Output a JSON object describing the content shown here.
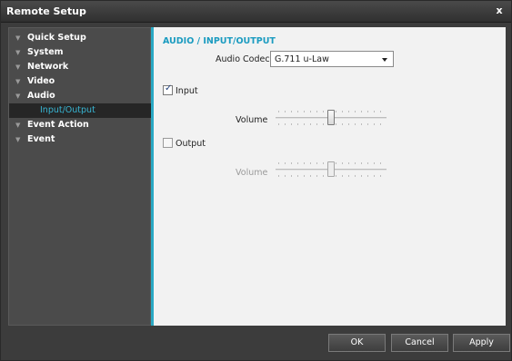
{
  "window": {
    "title": "Remote Setup",
    "close_label": "x"
  },
  "sidebar": {
    "items": [
      {
        "label": "Quick Setup"
      },
      {
        "label": "System"
      },
      {
        "label": "Network"
      },
      {
        "label": "Video"
      },
      {
        "label": "Audio"
      },
      {
        "label": "Event Action"
      },
      {
        "label": "Event"
      }
    ],
    "sub_items": [
      {
        "label": "Input/Output",
        "selected": true
      }
    ],
    "arrow_glyph": "▼"
  },
  "content": {
    "section_title": "AUDIO / INPUT/OUTPUT",
    "codec": {
      "label": "Audio Codec",
      "value": "G.711 u-Law"
    },
    "input": {
      "label": "Input",
      "checked": true,
      "volume_label": "Volume",
      "volume": 0.5
    },
    "output": {
      "label": "Output",
      "checked": false,
      "volume_label": "Volume",
      "volume": 0.5
    }
  },
  "footer": {
    "ok_label": "OK",
    "cancel_label": "Cancel",
    "apply_label": "Apply"
  },
  "colors": {
    "accent": "#2aa9c4",
    "selected_text": "#38b6d4",
    "section_title": "#1a9bc0"
  }
}
